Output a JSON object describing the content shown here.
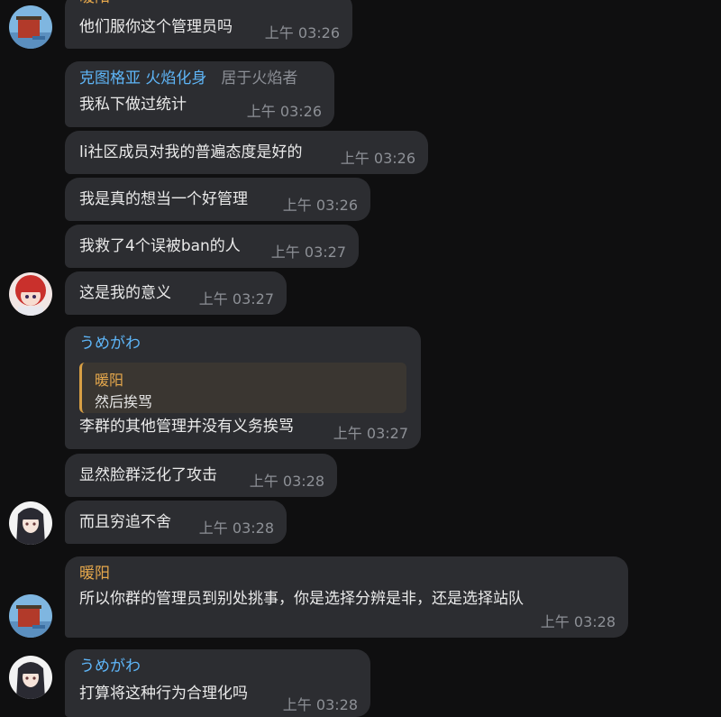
{
  "chat": {
    "m1": {
      "sender": "暖阳",
      "text": "他们服你这个管理员吗",
      "time": "上午 03:26"
    },
    "m2": {
      "sender": "克图格亚 火焰化身",
      "title": "居于火焰者",
      "text": "我私下做过统计",
      "time": "上午 03:26"
    },
    "m3": {
      "text": "li社区成员对我的普遍态度是好的",
      "time": "上午 03:26"
    },
    "m4": {
      "text": "我是真的想当一个好管理",
      "time": "上午 03:26"
    },
    "m5": {
      "text": "我救了4个误被ban的人",
      "time": "上午 03:27"
    },
    "m6": {
      "text": "这是我的意义",
      "time": "上午 03:27"
    },
    "m7": {
      "sender": "うめがわ",
      "reply_sender": "暖阳",
      "reply_text": "然后挨骂",
      "text": "李群的其他管理并没有义务挨骂",
      "time": "上午 03:27"
    },
    "m8": {
      "text": "显然脸群泛化了攻击",
      "time": "上午 03:28"
    },
    "m9": {
      "text": "而且穷追不舍",
      "time": "上午 03:28"
    },
    "m10": {
      "sender": "暖阳",
      "text": "所以你群的管理员到别处挑事，你是选择分辨是非，还是选择站队",
      "time": "上午 03:28"
    },
    "m11": {
      "sender": "うめがわ",
      "text": "打算将这种行为合理化吗",
      "time": "上午 03:28"
    }
  },
  "icons": {
    "avatar_nuanyang": "temple-avatar-icon",
    "avatar_ktgy": "anime-red-hair-avatar-icon",
    "avatar_umegawa": "anime-dark-hair-avatar-icon"
  },
  "colors": {
    "bubble": "#2c2d31",
    "name_blue": "#5eb5f7",
    "name_orange": "#e6a84c",
    "background": "#0f0f10"
  }
}
